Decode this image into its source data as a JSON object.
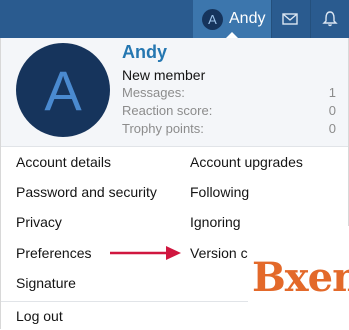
{
  "nav": {
    "avatar_letter": "A",
    "user_name": "Andy"
  },
  "profile": {
    "avatar_letter": "A",
    "name": "Andy",
    "title": "New member",
    "stats": [
      {
        "label": "Messages:",
        "value": "1"
      },
      {
        "label": "Reaction score:",
        "value": "0"
      },
      {
        "label": "Trophy points:",
        "value": "0"
      }
    ]
  },
  "menu": {
    "left": [
      "Account details",
      "Password and security",
      "Privacy",
      "Preferences",
      "Signature"
    ],
    "right": [
      "Account upgrades",
      "Following",
      "Ignoring",
      "Version che"
    ]
  },
  "logout_label": "Log out",
  "watermark": "Bxen",
  "colors": {
    "navbar": "#2a5b8f",
    "nav_active": "#3c76ad",
    "link_blue": "#2577b1",
    "arrow": "#d0163f",
    "watermark": "#e3692a"
  }
}
